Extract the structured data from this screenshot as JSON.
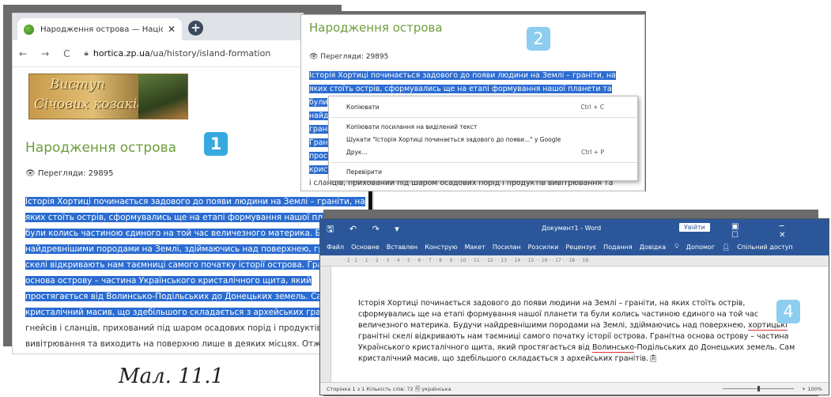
{
  "browser": {
    "tab_title": "Народження острова — Націо",
    "tab_close": "✕",
    "new_tab": "+",
    "nav_back": "←",
    "nav_forward": "→",
    "nav_reload": "C",
    "url_host": "hortica.zp.ua",
    "url_path": "/ua/history/island-formation",
    "banner_line1": "Виступ",
    "banner_line2": "Січових козаків",
    "page_title": "Народження острова",
    "views": "Перегляди: 29895",
    "text_selected": "Історія Хортиці починається задового до появи людини на Землі – граніти, на яких стоїть острів, сформувались ще на етапі формування нашої планети та були колись частиною єдиного на той час величезного материка. Будучи найдревнішими породами на Землі, здіймаючись над поверхнею, гранітні скелі відкривають нам таємниці самого початку історії острова. Гранітна основа острову – частина Українського кристалічного щита, який простягається від Волинсько-Подільських до Донецьких земель. Сам кристалічний масив, що здебільшого складається з архейських гранітів,",
    "text_rest": "гнейсів і сланців, прихований під шаром осадових порід і продуктів вивітрювання та виходить на поверхню лише в деяких місцях. Отже, острів Хортиця — це місце – глибока тріщина в масивній плиті, якою нині протікає Дніпро."
  },
  "badges": {
    "b1": "1",
    "b2": "2",
    "b4": "4"
  },
  "context": {
    "page_title": "Народження острова",
    "views": "Перегляди: 29895",
    "lines": [
      "Історія Хортиці починається задового до появи людини на Землі – граніти, на",
      "яких стоїть острів, сформувались ще на етапі формування нашої планети та",
      "були",
      "найдр",
      "граніт",
      "Граніт",
      "прост",
      "кристі"
    ],
    "last_line": "і сланців, прихований під шаром осадових порід і продуктів вивітрювання та",
    "menu": [
      {
        "label": "Копіювати",
        "shortcut": "Ctrl + C"
      },
      {
        "label": "Копіювати посилання на виділений текст",
        "shortcut": ""
      },
      {
        "label": "Шукати \"Історія Хортиці починається задового до появи...\" у Google",
        "shortcut": ""
      },
      {
        "label": "Друк...",
        "shortcut": "Ctrl + P"
      },
      {
        "label": "Перевірити",
        "shortcut": ""
      }
    ]
  },
  "word": {
    "quick_access": "🖫 ↶ ↷ ▾",
    "doc_title": "Документ1 - Word",
    "login": "Увійти",
    "window_controls": "▣ ─ ☐ ✕",
    "menu": [
      "Файл",
      "Основне",
      "Вставлен",
      "Конструю",
      "Макет",
      "Посилан",
      "Розсилки",
      "Рецензує",
      "Подання",
      "Довідка"
    ],
    "help": "Допомог",
    "share": "Спільний доступ",
    "ruler": "· 2 · 1 · · 1 · · 2 · · 3 · · 4 · · 5 · · 6 · · 7 · · 8 · · 9 · · 10 · · 11 · · 12 · · 13 · · 14 · · 15 · · 16 · · 17 · · 18 · · 19",
    "text_part1": "Історія Хортиці починається задового до появи людини на Землі – граніти, на яких стоїть острів, сформувались ще на етапі формування нашої планети та були колись частиною єдиного на той час величезного материка. Будучи найдревнішими породами на Землі, здіймаючись над поверхнею,",
    "text_underlined1": "хортицькі",
    "text_part2": "гранітні скелі відкривають нам таємниці самого початку історії острова. Гранітна основа острову – частина Українського кристалічного щита, який простягається від",
    "text_underlined2": "Волинсько",
    "text_part3": "-Подільських до Донецьких земель. Сам кристалічний масив, що здебільшого складається з архейських гранітів.",
    "status": "Сторінка 1 з 1    Кількість слів: 72    🗐    українська",
    "zoom": "+ 100%"
  },
  "caption": "Мал. 11.1"
}
